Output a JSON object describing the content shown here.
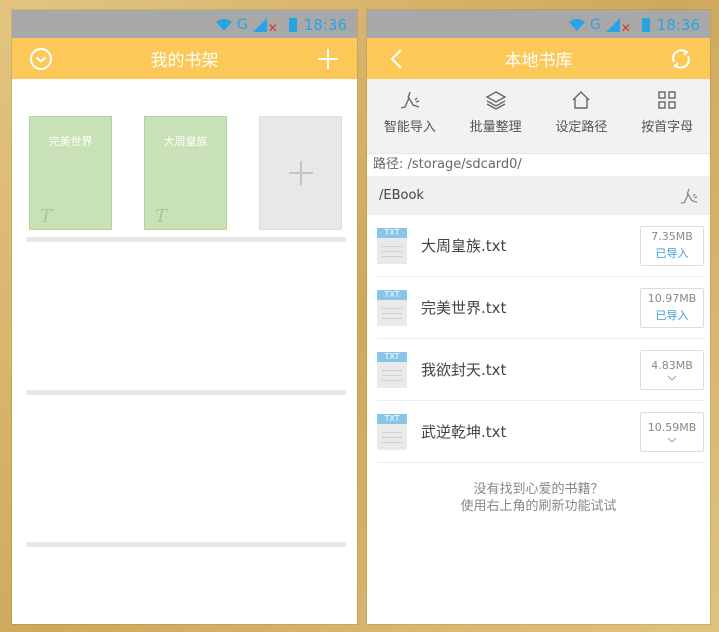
{
  "status_bar": {
    "time": "18:36",
    "network": "G"
  },
  "left_screen": {
    "title": "我的书架",
    "books": [
      {
        "title": "完美世界",
        "type_mark": "T"
      },
      {
        "title": "大周皇族",
        "type_mark": "T"
      }
    ]
  },
  "right_screen": {
    "title": "本地书库",
    "tools": [
      {
        "label": "智能导入",
        "icon": "smart-import-icon"
      },
      {
        "label": "批量整理",
        "icon": "layers-icon"
      },
      {
        "label": "设定路径",
        "icon": "home-icon"
      },
      {
        "label": "按首字母",
        "icon": "grid-icon"
      }
    ],
    "path": "路径: /storage/sdcard0/",
    "folder": "/EBook",
    "files": [
      {
        "tag": "TXT",
        "name": "大周皇族.txt",
        "size": "7.35MB",
        "status": "已导入"
      },
      {
        "tag": "TXT",
        "name": "完美世界.txt",
        "size": "10.97MB",
        "status": "已导入"
      },
      {
        "tag": "TXT",
        "name": "我欲封天.txt",
        "size": "4.83MB",
        "status": ""
      },
      {
        "tag": "TXT",
        "name": "武逆乾坤.txt",
        "size": "10.59MB",
        "status": ""
      }
    ],
    "hint_line1": "没有找到心爱的书籍？",
    "hint_line2": "使用右上角的刷新功能试试"
  },
  "colors": {
    "accent": "#fcc858",
    "book": "#c9e1b7",
    "link": "#3a9ddc"
  }
}
